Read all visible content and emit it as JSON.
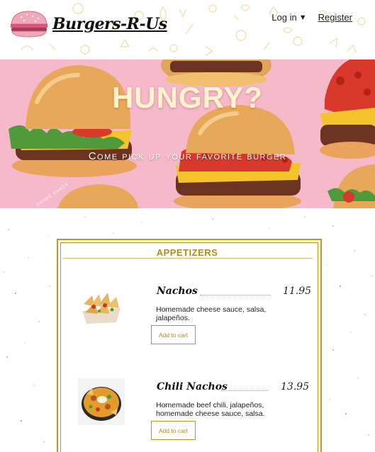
{
  "header": {
    "logo_text": "Burgers-R-Us",
    "login_label": "Log in",
    "login_caret": "▼",
    "register_label": "Register"
  },
  "hero": {
    "title": "HUNGRY?",
    "subtitle": "Come pick up your favorite burger",
    "watermark": "SHAKE SHACK"
  },
  "menu": {
    "section_title": "APPETIZERS",
    "items": [
      {
        "name": "Nachos",
        "price": "11.95",
        "description": "Homemade cheese sauce, salsa, jalapeños.",
        "button_label": "Add to cart"
      },
      {
        "name": "Chili Nachos",
        "price": "13.95",
        "description": "Homemade beef chili, jalapeños, homemade cheese sauce, salsa.",
        "button_label": "Add to cart"
      }
    ]
  },
  "colors": {
    "accent_gold": "#c3961d",
    "hero_pink": "#f5b9c9",
    "hero_title": "#fff4cc"
  }
}
